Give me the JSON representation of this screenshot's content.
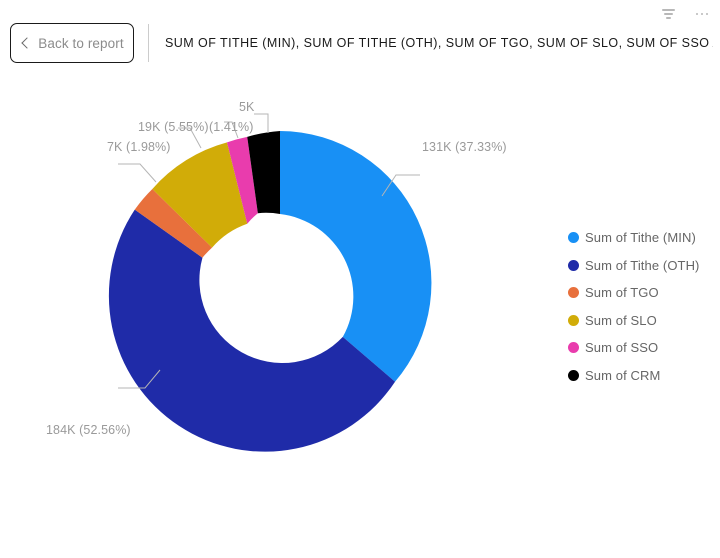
{
  "header": {
    "back_button_label": "Back to report",
    "back_icon": "chevron-left-icon",
    "report_title": "SUM OF TITHE (MIN), SUM OF TITHE (OTH), SUM OF TGO, SUM OF SLO, SUM OF SSO AND SU…",
    "filter_icon": "filter-icon",
    "more_options_icon": "ellipsis-icon"
  },
  "chart_data": {
    "type": "pie",
    "variant": "donut",
    "title": "SUM OF TITHE (MIN), SUM OF TITHE (OTH), SUM OF TGO, SUM OF SLO, SUM OF SSO AND SU…",
    "legend_position": "right",
    "categories": [
      "Sum of Tithe (MIN)",
      "Sum of Tithe (OTH)",
      "Sum of TGO",
      "Sum of SLO",
      "Sum of SSO",
      "Sum of CRM"
    ],
    "values": [
      131000,
      184000,
      7000,
      19000,
      5000,
      4000
    ],
    "percentages": [
      37.33,
      52.56,
      1.98,
      5.55,
      1.41,
      1.17
    ],
    "colors": [
      "#1890f5",
      "#1f2ba8",
      "#e8703c",
      "#d1ac08",
      "#e93cad",
      "#000000"
    ],
    "data_labels": [
      "131K (37.33%)",
      "184K (52.56%)",
      "7K (1.98%)",
      "19K (5.55%)",
      "(1.41%)",
      "5K"
    ]
  },
  "labels": {
    "tithe_min": "131K (37.33%)",
    "tithe_oth": "184K (52.56%)",
    "tgo": "7K (1.98%)",
    "slo": "19K (5.55%)",
    "sso": "(1.41%)",
    "crm": "5K"
  },
  "legend": {
    "items": [
      {
        "label": "Sum of Tithe (MIN)",
        "color": "#1890f5"
      },
      {
        "label": "Sum of Tithe (OTH)",
        "color": "#1f2ba8"
      },
      {
        "label": "Sum of TGO",
        "color": "#e8703c"
      },
      {
        "label": "Sum of SLO",
        "color": "#d1ac08"
      },
      {
        "label": "Sum of SSO",
        "color": "#e93cad"
      },
      {
        "label": "Sum of CRM",
        "color": "#000000"
      }
    ]
  }
}
